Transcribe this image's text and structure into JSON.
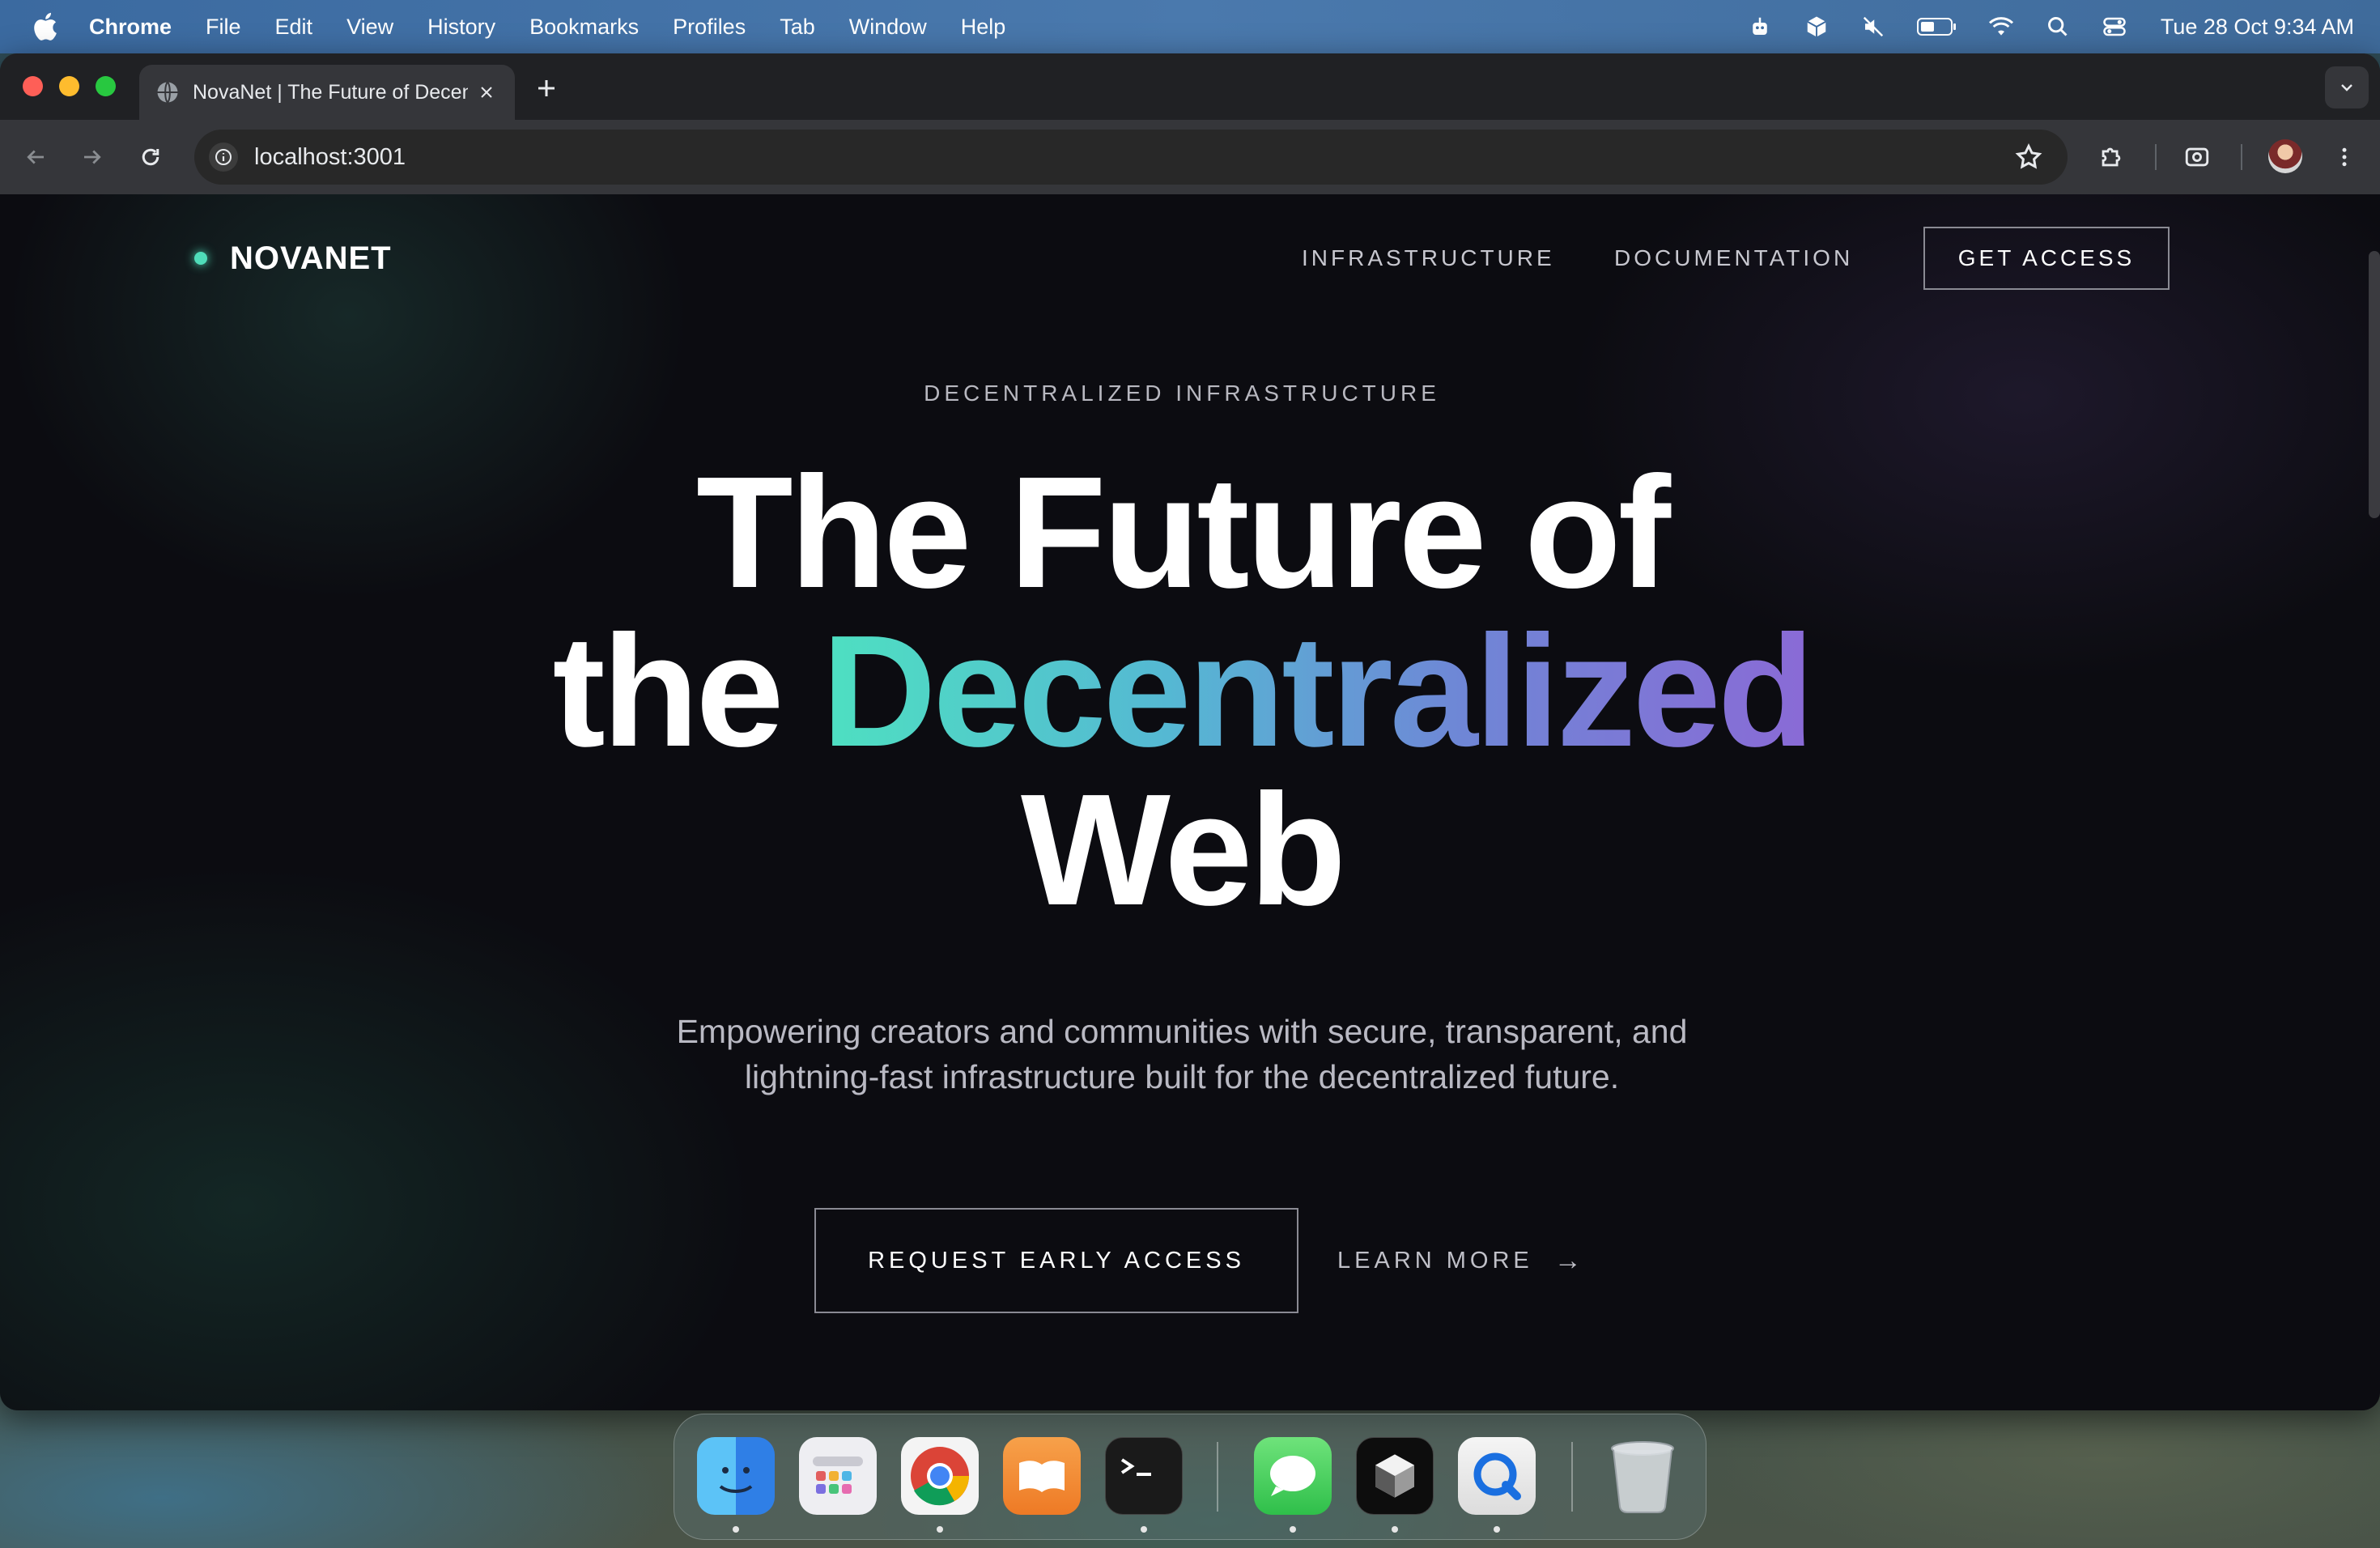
{
  "menubar": {
    "app_name": "Chrome",
    "items": [
      "File",
      "Edit",
      "View",
      "History",
      "Bookmarks",
      "Profiles",
      "Tab",
      "Window",
      "Help"
    ],
    "clock": "Tue 28 Oct  9:34 AM"
  },
  "browser": {
    "tab_title": "NovaNet | The Future of Decentralized Web",
    "url": "localhost:3001"
  },
  "page": {
    "logo": "NOVANET",
    "nav_links": [
      "INFRASTRUCTURE",
      "DOCUMENTATION"
    ],
    "cta_nav": "GET ACCESS",
    "eyebrow": "DECENTRALIZED INFRASTRUCTURE",
    "headline": {
      "line1": "The Future of",
      "line2_prefix": "the ",
      "line2_highlight": "Decentralized",
      "line3": "Web"
    },
    "subtitle": {
      "line1": "Empowering creators and communities with secure, transparent, and",
      "line2": "lightning-fast infrastructure built for the decentralized future."
    },
    "primary_button": "REQUEST EARLY ACCESS",
    "secondary_link": "LEARN MORE",
    "secondary_arrow": "→"
  },
  "colors": {
    "accent_teal": "#4ee0c1",
    "accent_purple": "#8a6ad6",
    "background": "#0c0c11"
  },
  "dock": {
    "apps": [
      "finder-icon",
      "launchpad-icon",
      "chrome-icon",
      "books-icon",
      "terminal-icon",
      "messages-icon",
      "cube-app-icon",
      "quicktime-icon",
      "trash-icon"
    ]
  }
}
